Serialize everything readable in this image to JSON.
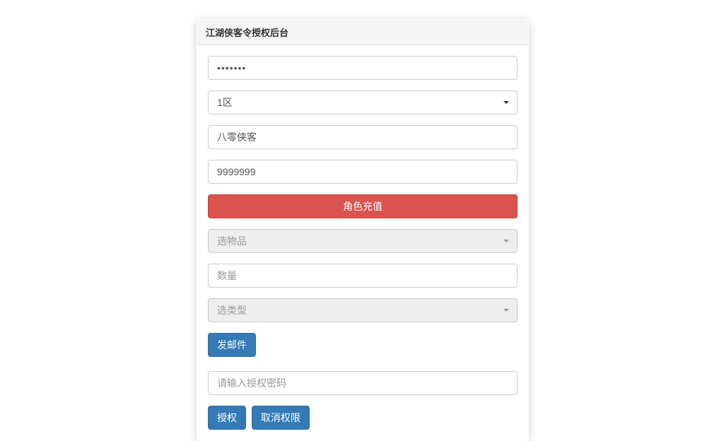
{
  "panel": {
    "title": "江湖侠客令授权后台"
  },
  "form": {
    "password_value": "•••••••",
    "region_selected": "1区",
    "character_value": "八零侠客",
    "amount_value": "9999999",
    "recharge_button": "角色充值",
    "item_select_placeholder": "选物品",
    "quantity_placeholder": "数量",
    "type_select_placeholder": "选类型",
    "send_mail_button": "发邮件",
    "auth_password_placeholder": "请输入授权密码",
    "authorize_button": "授权",
    "revoke_button": "取消权限"
  }
}
